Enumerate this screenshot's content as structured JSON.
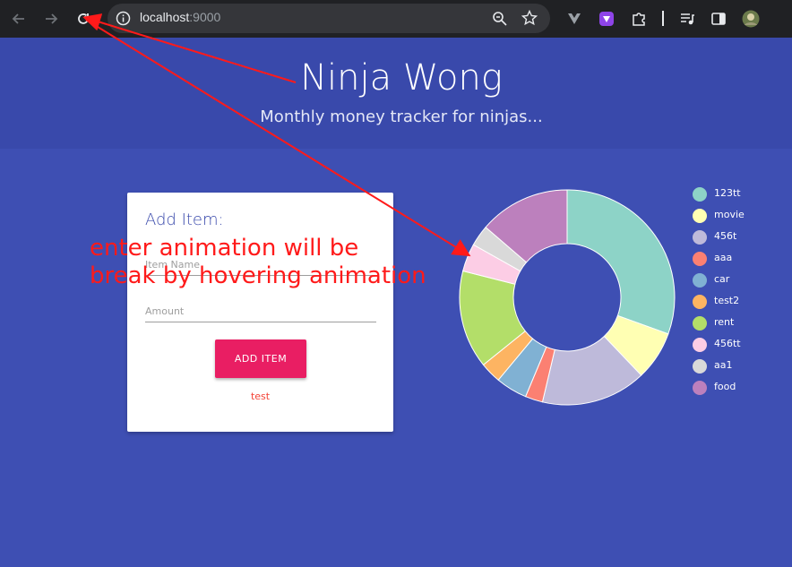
{
  "browser": {
    "url_host": "localhost",
    "url_port": ":9000"
  },
  "header": {
    "title": "Ninja Wong",
    "subtitle": "Monthly money tracker for ninjas..."
  },
  "form": {
    "title": "Add Item:",
    "name_placeholder": "Item Name",
    "amount_placeholder": "Amount",
    "add_button": "ADD ITEM",
    "error_text": "test"
  },
  "annotation": {
    "text": "enter animation will be break by hovering animation",
    "color": "#ff1a1a"
  },
  "chart_data": {
    "type": "pie",
    "categories": [
      "123tt",
      "movie",
      "456t",
      "aaa",
      "car",
      "test2",
      "rent",
      "456tt",
      "aa1",
      "food"
    ],
    "values": [
      29,
      7,
      15,
      2.5,
      4.5,
      3,
      14,
      4,
      3,
      13
    ],
    "colors": [
      "#8dd3c7",
      "#ffffb3",
      "#bebada",
      "#fb8072",
      "#80b1d3",
      "#fdb462",
      "#b3de69",
      "#fccde5",
      "#d9d9d9",
      "#bc80bd"
    ],
    "legend_position": "right"
  }
}
